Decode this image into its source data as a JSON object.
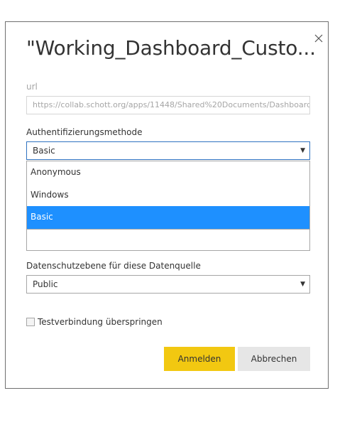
{
  "dialog": {
    "title": "\"Working_Dashboard_Custo...",
    "close_icon": "close-icon"
  },
  "url": {
    "label": "url",
    "value": "https://collab.schott.org/apps/11448/Shared%20Documents/Dashboard"
  },
  "auth": {
    "label": "Authentifizierungsmethode",
    "selected": "Basic",
    "options": [
      {
        "label": "Anonymous"
      },
      {
        "label": "Windows"
      },
      {
        "label": "Basic"
      }
    ]
  },
  "privacy": {
    "label": "Datenschutzebene für diese Datenquelle",
    "selected": "Public"
  },
  "skip_test": {
    "label": "Testverbindung überspringen",
    "checked": false
  },
  "buttons": {
    "signin": "Anmelden",
    "cancel": "Abbrechen"
  },
  "colors": {
    "accent_yellow": "#f2c811",
    "selection_blue": "#1e90ff"
  }
}
